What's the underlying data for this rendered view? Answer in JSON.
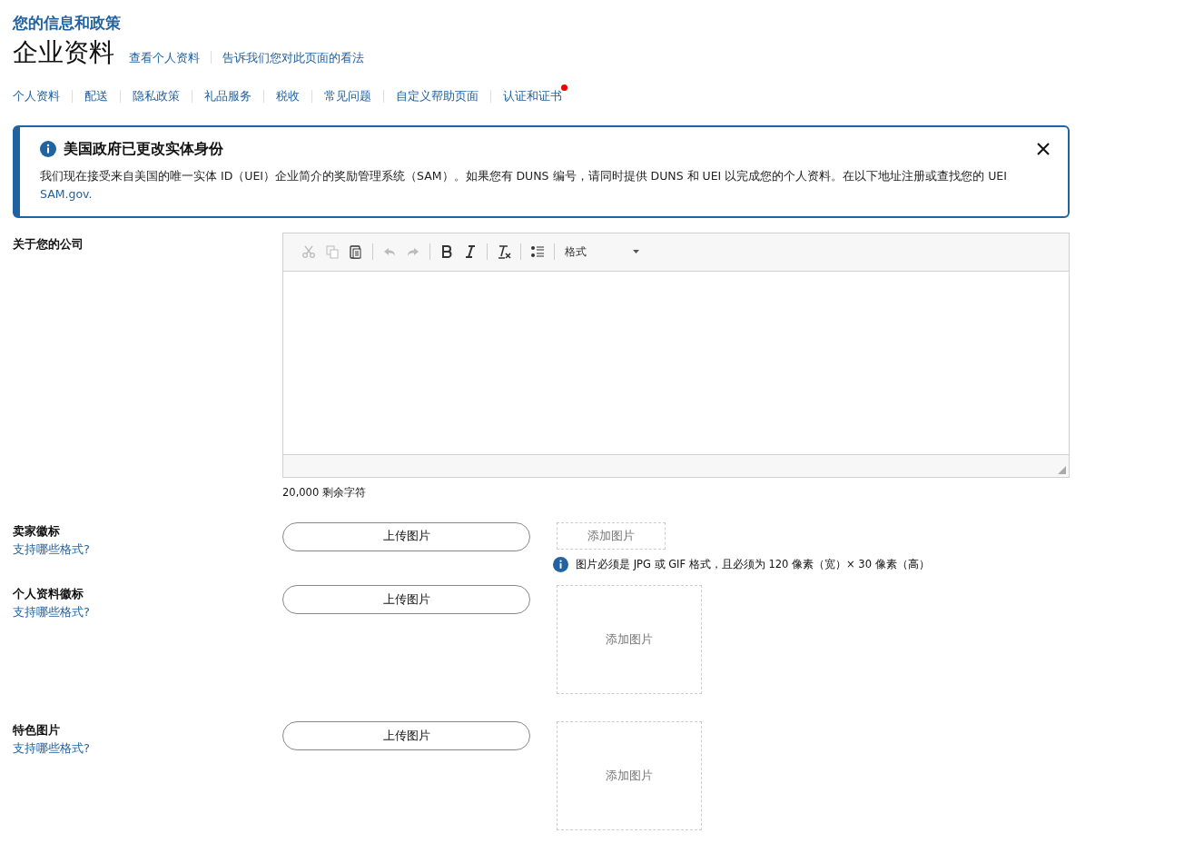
{
  "breadcrumb": "您的信息和政策",
  "page_title": "企业资料",
  "header_links": [
    "查看个人资料",
    "告诉我们您对此页面的看法"
  ],
  "nav": [
    {
      "label": "个人资料",
      "badge": false
    },
    {
      "label": "配送",
      "badge": false
    },
    {
      "label": "隐私政策",
      "badge": false
    },
    {
      "label": "礼品服务",
      "badge": false
    },
    {
      "label": "税收",
      "badge": false
    },
    {
      "label": "常见问题",
      "badge": false
    },
    {
      "label": "自定义帮助页面",
      "badge": false
    },
    {
      "label": "认证和证书",
      "badge": true
    }
  ],
  "alert": {
    "title": "美国政府已更改实体身份",
    "body": "我们现在接受来自美国的唯一实体 ID（UEI）企业简介的奖励管理系统（SAM）。如果您有 DUNS 编号，请同时提供 DUNS 和 UEI 以完成您的个人资料。在以下地址注册或查找您的 UEI",
    "link": "SAM.gov."
  },
  "about": {
    "label": "关于您的公司",
    "toolbar": [
      {
        "kind": "cut",
        "disabled": true
      },
      {
        "kind": "copy",
        "disabled": true
      },
      {
        "kind": "paste",
        "disabled": false
      },
      {
        "kind": "sep"
      },
      {
        "kind": "undo",
        "disabled": true
      },
      {
        "kind": "redo",
        "disabled": true
      },
      {
        "kind": "sep"
      },
      {
        "kind": "bold",
        "disabled": false
      },
      {
        "kind": "italic",
        "disabled": false
      },
      {
        "kind": "sep"
      },
      {
        "kind": "clear",
        "disabled": false
      },
      {
        "kind": "sep"
      },
      {
        "kind": "list",
        "disabled": false
      },
      {
        "kind": "sep"
      }
    ],
    "format_label": "格式",
    "remaining": "20,000 剩余字符"
  },
  "uploads": [
    {
      "label": "卖家徽标",
      "help": "支持哪些格式?",
      "button": "上传图片",
      "preview": "添加图片",
      "kind": "banner",
      "note": "图片必须是 JPG 或 GIF 格式，且必须为 120 像素（宽）× 30 像素（高）"
    },
    {
      "label": "个人资料徽标",
      "help": "支持哪些格式?",
      "button": "上传图片",
      "preview": "添加图片",
      "kind": "square"
    },
    {
      "label": "特色图片",
      "help": "支持哪些格式?",
      "button": "上传图片",
      "preview": "添加图片",
      "kind": "square"
    }
  ]
}
